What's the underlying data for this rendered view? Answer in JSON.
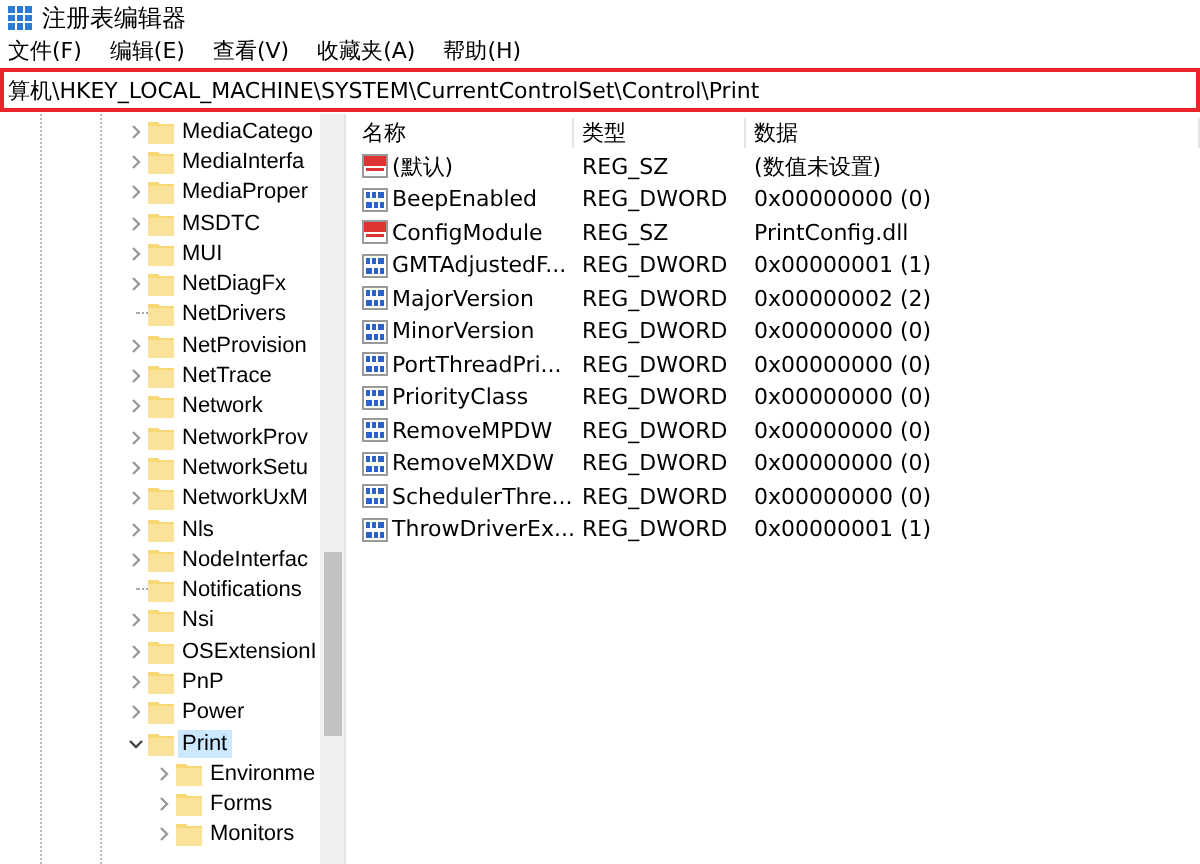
{
  "window": {
    "title": "注册表编辑器"
  },
  "menu": [
    {
      "label": "文件(F)"
    },
    {
      "label": "编辑(E)"
    },
    {
      "label": "查看(V)"
    },
    {
      "label": "收藏夹(A)"
    },
    {
      "label": "帮助(H)"
    }
  ],
  "address": {
    "value": "算机\\HKEY_LOCAL_MACHINE\\SYSTEM\\CurrentControlSet\\Control\\Print",
    "highlighted": true
  },
  "tree": {
    "items": [
      {
        "label": "MediaCatego",
        "kind": "expandable",
        "expanded": false,
        "selected": false
      },
      {
        "label": "MediaInterfa",
        "kind": "expandable",
        "expanded": false,
        "selected": false
      },
      {
        "label": "MediaProper",
        "kind": "expandable",
        "expanded": false,
        "selected": false
      },
      {
        "label": "MSDTC",
        "kind": "expandable",
        "expanded": false,
        "selected": false
      },
      {
        "label": "MUI",
        "kind": "expandable",
        "expanded": false,
        "selected": false
      },
      {
        "label": "NetDiagFx",
        "kind": "expandable",
        "expanded": false,
        "selected": false
      },
      {
        "label": "NetDrivers",
        "kind": "leaf",
        "selected": false
      },
      {
        "label": "NetProvision",
        "kind": "expandable",
        "expanded": false,
        "selected": false
      },
      {
        "label": "NetTrace",
        "kind": "expandable",
        "expanded": false,
        "selected": false
      },
      {
        "label": "Network",
        "kind": "expandable",
        "expanded": false,
        "selected": false
      },
      {
        "label": "NetworkProv",
        "kind": "expandable",
        "expanded": false,
        "selected": false
      },
      {
        "label": "NetworkSetu",
        "kind": "expandable",
        "expanded": false,
        "selected": false
      },
      {
        "label": "NetworkUxM",
        "kind": "expandable",
        "expanded": false,
        "selected": false
      },
      {
        "label": "Nls",
        "kind": "expandable",
        "expanded": false,
        "selected": false
      },
      {
        "label": "NodeInterfac",
        "kind": "expandable",
        "expanded": false,
        "selected": false
      },
      {
        "label": "Notifications",
        "kind": "leaf",
        "selected": false
      },
      {
        "label": "Nsi",
        "kind": "expandable",
        "expanded": false,
        "selected": false
      },
      {
        "label": "OSExtensionI",
        "kind": "expandable",
        "expanded": false,
        "selected": false
      },
      {
        "label": "PnP",
        "kind": "expandable",
        "expanded": false,
        "selected": false
      },
      {
        "label": "Power",
        "kind": "expandable",
        "expanded": false,
        "selected": false
      },
      {
        "label": "Print",
        "kind": "expandable",
        "expanded": true,
        "selected": true,
        "children": [
          {
            "label": "Environme",
            "kind": "expandable",
            "expanded": false,
            "selected": false
          },
          {
            "label": "Forms",
            "kind": "expandable",
            "expanded": false,
            "selected": false
          },
          {
            "label": "Monitors",
            "kind": "expandable",
            "expanded": false,
            "selected": false
          }
        ]
      }
    ]
  },
  "values": {
    "columns": [
      "名称",
      "类型",
      "数据"
    ],
    "rows": [
      {
        "kind": "string",
        "name": "(默认)",
        "type": "REG_SZ",
        "data": "(数值未设置)"
      },
      {
        "kind": "dword",
        "name": "BeepEnabled",
        "type": "REG_DWORD",
        "data": "0x00000000 (0)"
      },
      {
        "kind": "string",
        "name": "ConfigModule",
        "type": "REG_SZ",
        "data": "PrintConfig.dll"
      },
      {
        "kind": "dword",
        "name": "GMTAdjustedF...",
        "type": "REG_DWORD",
        "data": "0x00000001 (1)"
      },
      {
        "kind": "dword",
        "name": "MajorVersion",
        "type": "REG_DWORD",
        "data": "0x00000002 (2)"
      },
      {
        "kind": "dword",
        "name": "MinorVersion",
        "type": "REG_DWORD",
        "data": "0x00000000 (0)"
      },
      {
        "kind": "dword",
        "name": "PortThreadPri...",
        "type": "REG_DWORD",
        "data": "0x00000000 (0)"
      },
      {
        "kind": "dword",
        "name": "PriorityClass",
        "type": "REG_DWORD",
        "data": "0x00000000 (0)"
      },
      {
        "kind": "dword",
        "name": "RemoveMPDW",
        "type": "REG_DWORD",
        "data": "0x00000000 (0)"
      },
      {
        "kind": "dword",
        "name": "RemoveMXDW",
        "type": "REG_DWORD",
        "data": "0x00000000 (0)"
      },
      {
        "kind": "dword",
        "name": "SchedulerThre...",
        "type": "REG_DWORD",
        "data": "0x00000000 (0)"
      },
      {
        "kind": "dword",
        "name": "ThrowDriverEx...",
        "type": "REG_DWORD",
        "data": "0x00000001 (1)"
      }
    ]
  }
}
